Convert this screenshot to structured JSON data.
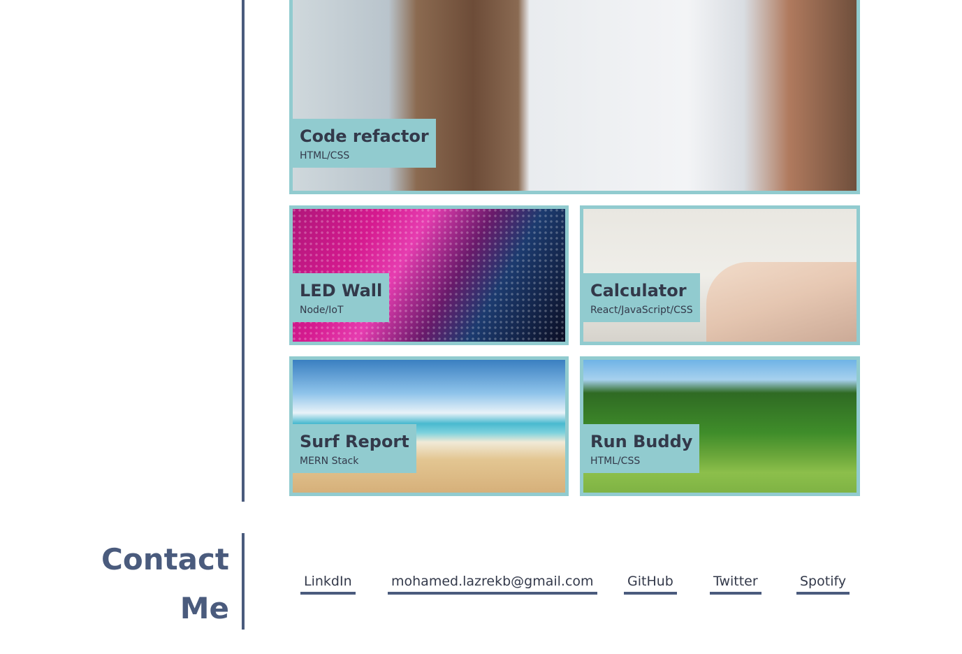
{
  "projects": [
    {
      "title": "Code refactor",
      "tech": "HTML/CSS"
    },
    {
      "title": "LED Wall",
      "tech": "Node/IoT"
    },
    {
      "title": "Calculator",
      "tech": "React/JavaScript/CSS"
    },
    {
      "title": "Surf Report",
      "tech": "MERN Stack"
    },
    {
      "title": "Run Buddy",
      "tech": "HTML/CSS"
    }
  ],
  "contact": {
    "heading": "Contact Me",
    "links": [
      {
        "label": "LinkdIn"
      },
      {
        "label": "mohamed.lazrekb@gmail.com"
      },
      {
        "label": "GitHub"
      },
      {
        "label": "Twitter"
      },
      {
        "label": "Spotify"
      }
    ]
  },
  "colors": {
    "accent": "#91cbcf",
    "brand": "#4a5b7d",
    "text": "#33394a"
  }
}
